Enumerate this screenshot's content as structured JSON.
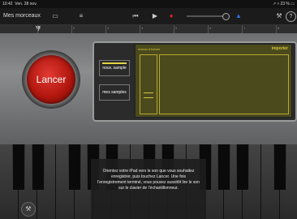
{
  "status": {
    "time": "10:42",
    "date": "Ven. 28 nov.",
    "right": "↗ ▿ 23 % ▭"
  },
  "toolbar": {
    "title": "Mes morceaux",
    "icons": [
      "camera-icon",
      "mixer-icon",
      "rewind-icon",
      "play-icon",
      "record-icon",
      "volume-slider",
      "metronome-icon",
      "wrench-icon",
      "help-icon"
    ],
    "glyphs": {
      "camera": "▭",
      "mixer": "≡",
      "rewind": "⏮",
      "play": "▶",
      "record": "●",
      "metronome": "▲",
      "wrench": "⚒",
      "help": "?"
    }
  },
  "ruler": {
    "marks": [
      "1",
      "2",
      "3",
      "4",
      "5",
      "6",
      "7",
      "8"
    ]
  },
  "sampler": {
    "launch_label": "Lancer",
    "new_sample_label": "nouv. sample",
    "my_samples_label": "mes samples",
    "input_level_label": "niveau d'entrée",
    "import_label": "importer"
  },
  "hint": "Orientez votre iPad vers le son que vous souhaitez enregistrer, puis touchez Lancer. Une fois l’enregistrement terminé, vous pouvez aussitôt lire le son sur le clavier de l’échantillonneur.",
  "colors": {
    "record": "#e32222",
    "metronome": "#2f6fe6",
    "launch": "#c0221a",
    "screen_text": "#d8c53b"
  }
}
